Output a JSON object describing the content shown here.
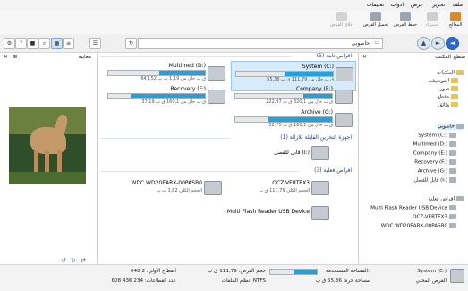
{
  "menu": [
    "ملف",
    "تحرير",
    "عرض",
    "ادوات",
    "تعليمات"
  ],
  "ribbon": {
    "buttons": [
      {
        "label": "المعالج",
        "icon": "wizard-icon",
        "disabled": false
      },
      {
        "label": "استيراد",
        "icon": "import-icon",
        "disabled": true
      },
      {
        "label": "حفظ القرص",
        "icon": "save-disk-icon",
        "disabled": false
      },
      {
        "label": "تحميل القرص",
        "icon": "load-disk-icon",
        "disabled": false
      },
      {
        "label": "اغلاق القرص",
        "icon": "close-disk-icon",
        "disabled": true
      }
    ]
  },
  "address": {
    "path": "حاسوبي",
    "desktop_label": "سطح المكتب"
  },
  "preview": {
    "title": "معاينة"
  },
  "nav": {
    "libraries": "المكتبات",
    "items": [
      "الموسيقى",
      "صور",
      "مقطع",
      "وثائق"
    ],
    "computer": "حاسوبي",
    "drives": [
      "System (C:)",
      "Multimed (D:)",
      "Company (E:)",
      "Recovery (F:)",
      "Archive (G:)",
      "قابل للفصل (I:)"
    ],
    "physical": "اقراص فعلية",
    "physical_items": [
      "Multi Flash Reader USB Device",
      "OCZ-VERTEX3",
      "WDC WD20EARX-00PASB0"
    ]
  },
  "groups": {
    "fixed": "اقراص ثابتة (5)",
    "removable": "اجهزة التخزين القابلة للازالة (1)",
    "physical": "اقراص فعلية (3)"
  },
  "fixed_drives": [
    {
      "name": "System (C:)",
      "free": "55,36 ق ب خال من 111,79 ق ب",
      "used": 0.5,
      "selected": true
    },
    {
      "name": "Multimed (D:)",
      "free": "641,52 ق ب خال من 1,19 ت ب",
      "used": 0.47,
      "selected": false
    },
    {
      "name": "Company (E:)",
      "free": "222,97 ق ب خال من 320,1 ق ب",
      "used": 0.3,
      "selected": false
    },
    {
      "name": "Recovery (F:)",
      "free": "37,19 ق ب خال من 160,1 ق ب",
      "used": 0.77,
      "selected": false
    },
    {
      "name": "Archive (G:)",
      "free": "52,75 ق ب خال من 160,1 ق ب",
      "used": 0.67,
      "selected": false
    }
  ],
  "removable": {
    "name": "قابل للفصل (I:)"
  },
  "physical_drives": [
    {
      "name": "OCZ-VERTEX3",
      "sub": "الحجم الكلي 111,79 ق ب"
    },
    {
      "name": "WDC WD20EARX-00PASB0",
      "sub": "الحجم الكلي 1,82 ت ب"
    },
    {
      "name": "Multi Flash Reader USB Device",
      "sub": ""
    }
  ],
  "status": {
    "drive_name": "System (C:)",
    "drive_type": "القرص المحلي",
    "used_label": "المساحة المستخدمة:",
    "free_label": "مساحة حرة: 55,36 ق ب",
    "size_label": "حجم القرص: 111,79 ق ب",
    "fs_label": "نظام الملفات: NTFS",
    "first_sector": "القطاع الأولي: 2 048",
    "sector_count": "عدد القطاعات: 234 436 608",
    "used_fraction": 0.5
  }
}
